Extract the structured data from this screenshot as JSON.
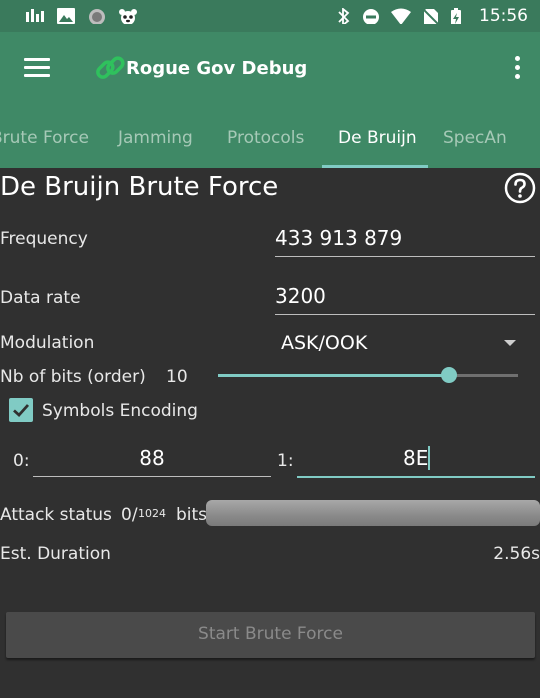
{
  "status_bar": {
    "time": "15:56",
    "icons": [
      "signal-bars-icon",
      "image-icon",
      "record-icon",
      "panda-icon",
      "bluetooth-icon",
      "do-not-disturb-icon",
      "wifi-icon",
      "no-sim-icon",
      "battery-charging-icon"
    ]
  },
  "toolbar": {
    "title": "Rogue Gov Debug"
  },
  "tabs": [
    {
      "label": "Brute Force"
    },
    {
      "label": "Jamming"
    },
    {
      "label": "Protocols"
    },
    {
      "label": "De Bruijn"
    },
    {
      "label": "SpecAn"
    }
  ],
  "active_tab": 3,
  "page": {
    "heading": "De Bruijn Brute Force"
  },
  "form": {
    "frequency_label": "Frequency",
    "frequency_value": "433 913 879",
    "data_rate_label": "Data rate",
    "data_rate_value": "3200",
    "modulation_label": "Modulation",
    "modulation_value": "ASK/OOK",
    "bits_label": "Nb of bits (order)",
    "bits_value": "10",
    "bits_slider_fraction": 0.77,
    "symbols_label": "Symbols Encoding",
    "symbols_checked": true,
    "sym0_label": "0:",
    "sym0_value": "88",
    "sym1_label": "1:",
    "sym1_value": "8E"
  },
  "attack": {
    "status_label": "Attack status",
    "progress_count": "0/",
    "progress_total": "1024",
    "progress_unit": "bits",
    "progress_fraction": 0,
    "duration_label": "Est. Duration",
    "duration_value": "2.56s"
  },
  "start_button": {
    "label": "Start Brute Force"
  },
  "colors": {
    "accent": "#80cbc4",
    "toolbar": "#3f8966",
    "status_bar": "#3a7a5c",
    "background": "#303030"
  }
}
